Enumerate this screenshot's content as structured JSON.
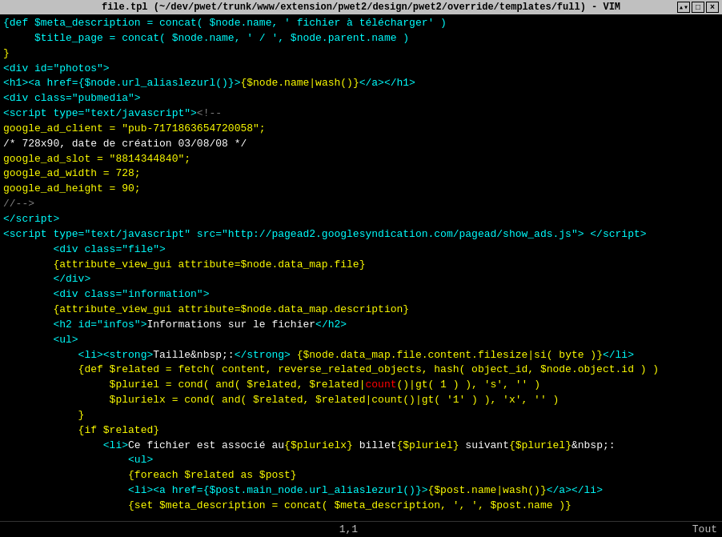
{
  "titlebar": {
    "title": "file.tpl (~/dev/pwet/trunk/www/extension/pwet2/design/pwet2/override/templates/full) - VIM",
    "controls": [
      "▴▾",
      "—",
      "□",
      "×"
    ]
  },
  "statusbar": {
    "left": "",
    "position": "1,1",
    "right": "Tout"
  }
}
